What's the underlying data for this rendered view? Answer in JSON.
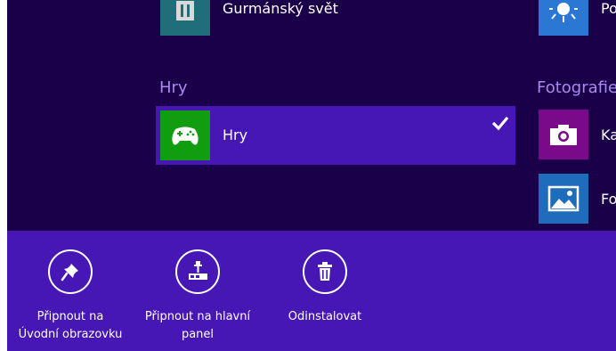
{
  "start_screen": {
    "top_apps": {
      "left_app_name": "Gurmánský svět"
    },
    "groups": [
      {
        "header": "Hry",
        "apps": [
          {
            "name": "Hry",
            "icon": "xbox-controller-icon",
            "tile_color": "#109d10",
            "selected": true
          }
        ]
      },
      {
        "header": "Fotografie",
        "apps": [
          {
            "name": "Kamera",
            "icon": "camera-icon",
            "tile_color": "#7a0a8a"
          },
          {
            "name": "Fotografie",
            "icon": "photo-icon",
            "tile_color": "#1f6cbc"
          }
        ]
      }
    ]
  },
  "app_bar": {
    "commands": [
      {
        "label": "Připnout na\nÚvodní obrazovku",
        "icon": "pin-icon"
      },
      {
        "label": "Připnout na hlavní\npanel",
        "icon": "taskbar-pin-icon"
      },
      {
        "label": "Odinstalovat",
        "icon": "trash-icon"
      }
    ]
  },
  "colors": {
    "background": "#1a0048",
    "accent": "#4617b4",
    "group_header": "#a78af0"
  }
}
